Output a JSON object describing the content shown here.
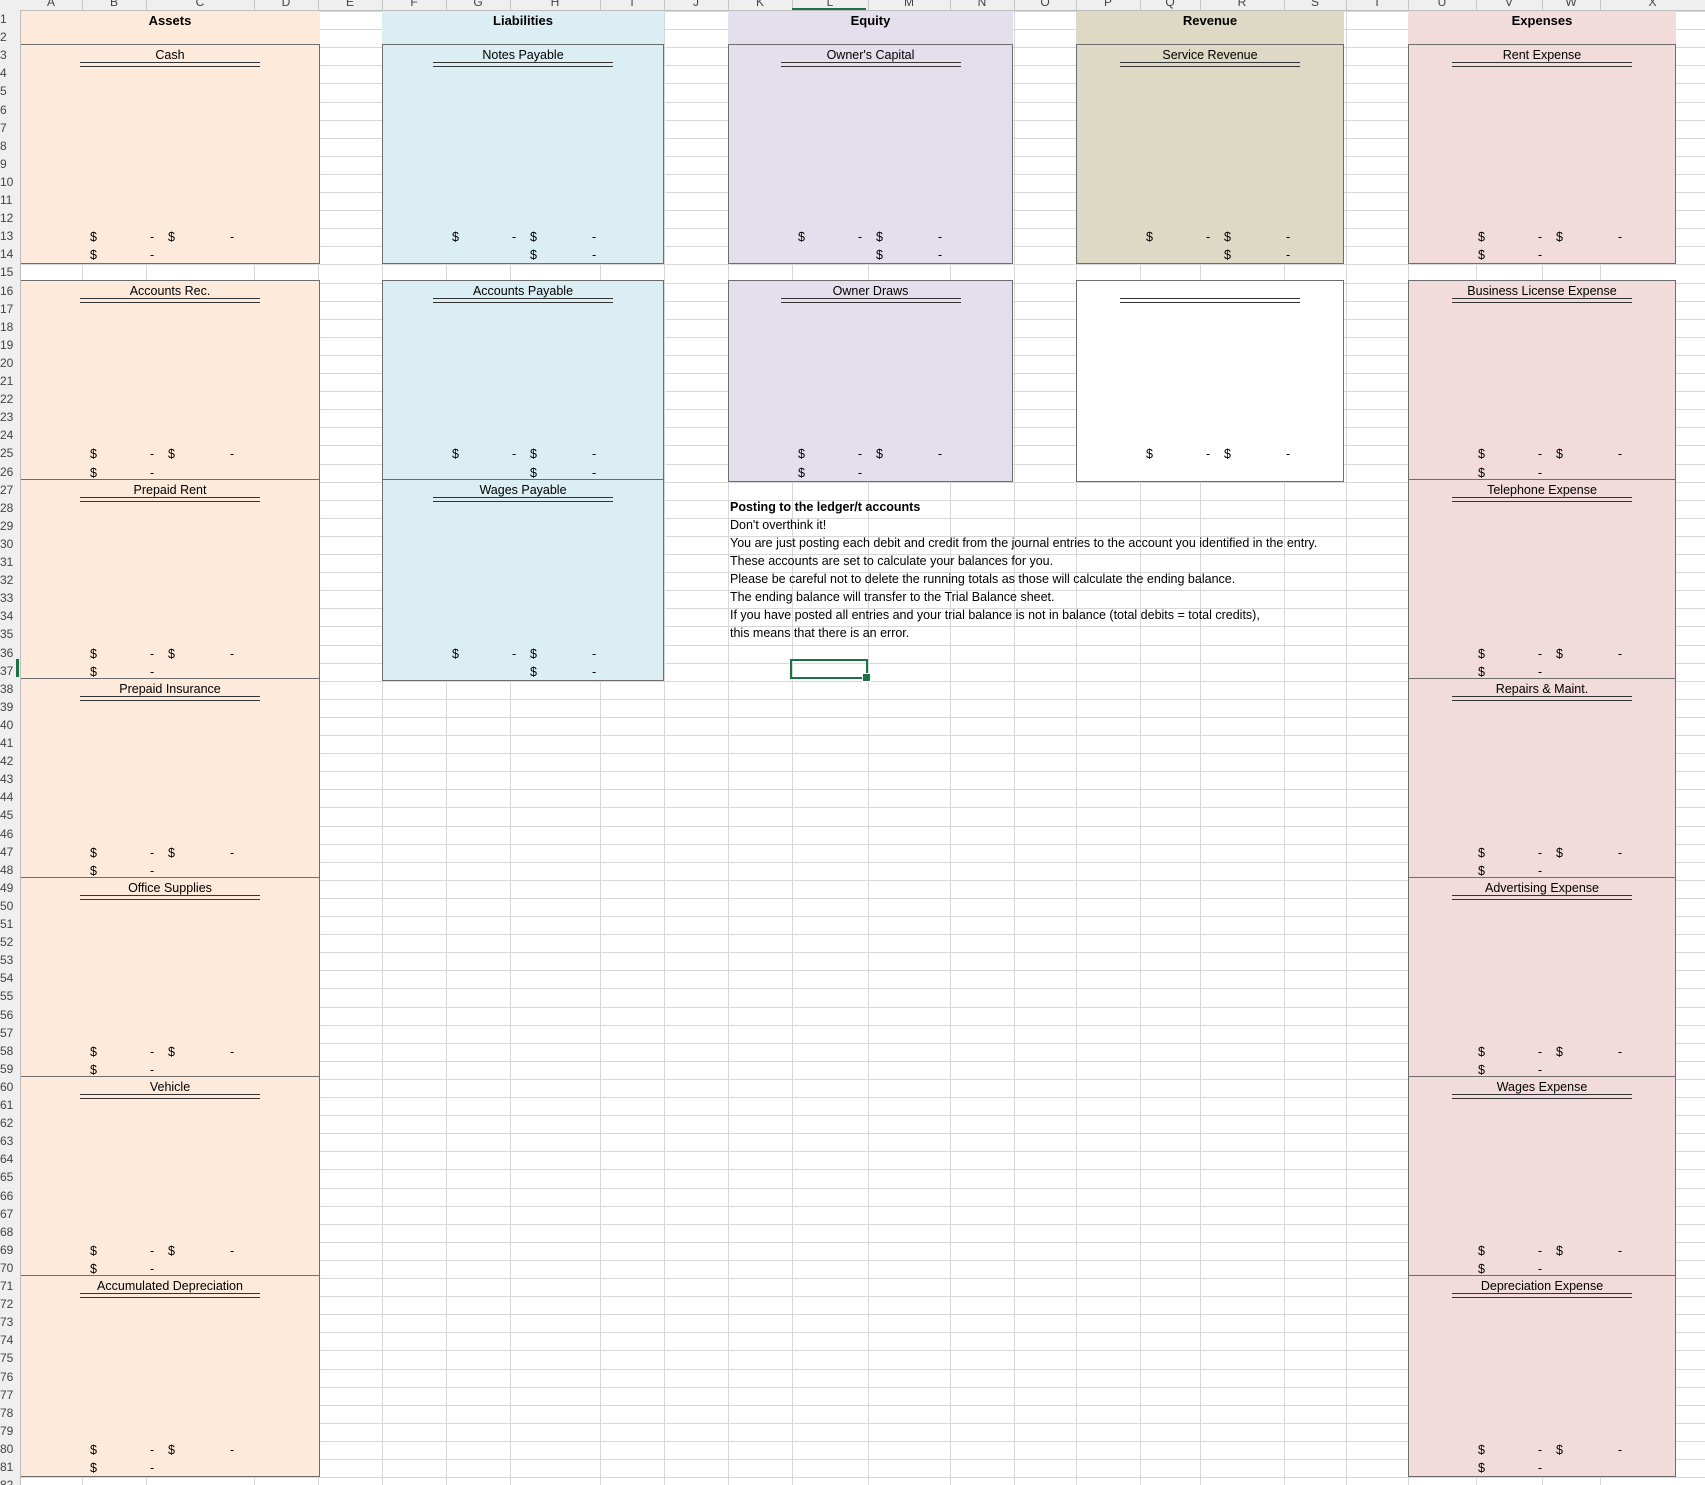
{
  "columns": [
    "A",
    "B",
    "C",
    "D",
    "E",
    "F",
    "G",
    "H",
    "I",
    "J",
    "K",
    "L",
    "M",
    "N",
    "O",
    "P",
    "Q",
    "R",
    "S",
    "T",
    "U",
    "V",
    "W",
    "X"
  ],
  "rows": [
    "1",
    "2",
    "3",
    "4",
    "5",
    "6",
    "7",
    "8",
    "9",
    "10",
    "11",
    "12",
    "13",
    "14",
    "15",
    "16",
    "17",
    "18",
    "19",
    "20",
    "21",
    "22",
    "23",
    "24",
    "25",
    "26",
    "27",
    "28",
    "29",
    "30",
    "31",
    "32",
    "33",
    "34",
    "35",
    "36",
    "37",
    "38",
    "39",
    "40",
    "41",
    "42",
    "43",
    "44",
    "45",
    "46",
    "47",
    "48",
    "49",
    "50",
    "51",
    "52",
    "53",
    "54",
    "55",
    "56",
    "57",
    "58",
    "59",
    "60",
    "61",
    "62",
    "63",
    "64",
    "65",
    "66",
    "67",
    "68",
    "69",
    "70",
    "71",
    "72",
    "73",
    "74",
    "75",
    "76",
    "77",
    "78",
    "79",
    "80",
    "81",
    "82"
  ],
  "active_cell": "L37",
  "colors": {
    "assets": "#fdeadb",
    "liabilities": "#daeef3",
    "equity": "#e4dfec",
    "revenue": "#ddd9c4",
    "expenses": "#f2dcdb",
    "selection": "#1e7145"
  },
  "sections": [
    {
      "key": "assets",
      "title": "Assets",
      "accounts": [
        {
          "name": "Cash",
          "debit_symbol": "$",
          "debit_total": "-",
          "credit_symbol": "$",
          "credit_total": "-",
          "balance_symbol": "$",
          "balance": "-"
        },
        {
          "name": "Accounts Rec.",
          "debit_symbol": "$",
          "debit_total": "-",
          "credit_symbol": "$",
          "credit_total": "-",
          "balance_symbol": "$",
          "balance": "-"
        },
        {
          "name": "Prepaid Rent",
          "debit_symbol": "$",
          "debit_total": "-",
          "credit_symbol": "$",
          "credit_total": "-",
          "balance_symbol": "$",
          "balance": "-"
        },
        {
          "name": "Prepaid Insurance",
          "debit_symbol": "$",
          "debit_total": "-",
          "credit_symbol": "$",
          "credit_total": "-",
          "balance_symbol": "$",
          "balance": "-"
        },
        {
          "name": "Office Supplies",
          "debit_symbol": "$",
          "debit_total": "-",
          "credit_symbol": "$",
          "credit_total": "-",
          "balance_symbol": "$",
          "balance": "-"
        },
        {
          "name": "Vehicle",
          "debit_symbol": "$",
          "debit_total": "-",
          "credit_symbol": "$",
          "credit_total": "-",
          "balance_symbol": "$",
          "balance": "-"
        },
        {
          "name": "Accumulated Depreciation",
          "debit_symbol": "$",
          "debit_total": "-",
          "credit_symbol": "$",
          "credit_total": "-",
          "balance_symbol": "$",
          "balance": "-"
        }
      ]
    },
    {
      "key": "liabilities",
      "title": "Liabilities",
      "accounts": [
        {
          "name": "Notes Payable",
          "debit_symbol": "$",
          "debit_total": "-",
          "credit_symbol": "$",
          "credit_total": "-",
          "balance_symbol": "$",
          "balance": "-"
        },
        {
          "name": "Accounts Payable",
          "debit_symbol": "$",
          "debit_total": "-",
          "credit_symbol": "$",
          "credit_total": "-",
          "balance_symbol": "$",
          "balance": "-"
        },
        {
          "name": "Wages Payable",
          "debit_symbol": "$",
          "debit_total": "-",
          "credit_symbol": "$",
          "credit_total": "-",
          "balance_symbol": "$",
          "balance": "-"
        }
      ]
    },
    {
      "key": "equity",
      "title": "Equity",
      "accounts": [
        {
          "name": "Owner's Capital",
          "debit_symbol": "$",
          "debit_total": "-",
          "credit_symbol": "$",
          "credit_total": "-",
          "balance_symbol": "$",
          "balance": "-"
        },
        {
          "name": "Owner Draws",
          "debit_symbol": "$",
          "debit_total": "-",
          "credit_symbol": "$",
          "credit_total": "-",
          "balance_symbol": "$",
          "balance": "-"
        }
      ]
    },
    {
      "key": "revenue",
      "title": "Revenue",
      "accounts": [
        {
          "name": "Service Revenue",
          "debit_symbol": "$",
          "debit_total": "-",
          "credit_symbol": "$",
          "credit_total": "-",
          "balance_symbol": "$",
          "balance": "-"
        },
        {
          "name": "",
          "debit_symbol": "$",
          "debit_total": "-",
          "credit_symbol": "$",
          "credit_total": "-",
          "balance_symbol": "",
          "balance": ""
        }
      ]
    },
    {
      "key": "expenses",
      "title": "Expenses",
      "accounts": [
        {
          "name": "Rent Expense",
          "debit_symbol": "$",
          "debit_total": "-",
          "credit_symbol": "$",
          "credit_total": "-",
          "balance_symbol": "$",
          "balance": "-"
        },
        {
          "name": "Business License Expense",
          "debit_symbol": "$",
          "debit_total": "-",
          "credit_symbol": "$",
          "credit_total": "-",
          "balance_symbol": "$",
          "balance": "-"
        },
        {
          "name": "Telephone Expense",
          "debit_symbol": "$",
          "debit_total": "-",
          "credit_symbol": "$",
          "credit_total": "-",
          "balance_symbol": "$",
          "balance": "-"
        },
        {
          "name": "Repairs & Maint.",
          "debit_symbol": "$",
          "debit_total": "-",
          "credit_symbol": "$",
          "credit_total": "-",
          "balance_symbol": "$",
          "balance": "-"
        },
        {
          "name": "Advertising Expense",
          "debit_symbol": "$",
          "debit_total": "-",
          "credit_symbol": "$",
          "credit_total": "-",
          "balance_symbol": "$",
          "balance": "-"
        },
        {
          "name": "Wages Expense",
          "debit_symbol": "$",
          "debit_total": "-",
          "credit_symbol": "$",
          "credit_total": "-",
          "balance_symbol": "$",
          "balance": "-"
        },
        {
          "name": "Depreciation Expense",
          "debit_symbol": "$",
          "debit_total": "-",
          "credit_symbol": "$",
          "credit_total": "-",
          "balance_symbol": "$",
          "balance": "-"
        }
      ]
    }
  ],
  "notes": {
    "heading": "Posting to the ledger/t accounts",
    "lines": [
      "Don't overthink it!",
      "You are just posting each debit and credit from the journal entries to the account you identified in the entry.",
      "These accounts are set to calculate your balances for you.",
      "Please be careful not to delete the running totals as those will calculate the ending balance.",
      "The ending balance will transfer to the Trial Balance sheet.",
      "If you have posted all entries and your trial balance is not in balance (total debits = total credits),",
      "this means that there is an error."
    ]
  }
}
